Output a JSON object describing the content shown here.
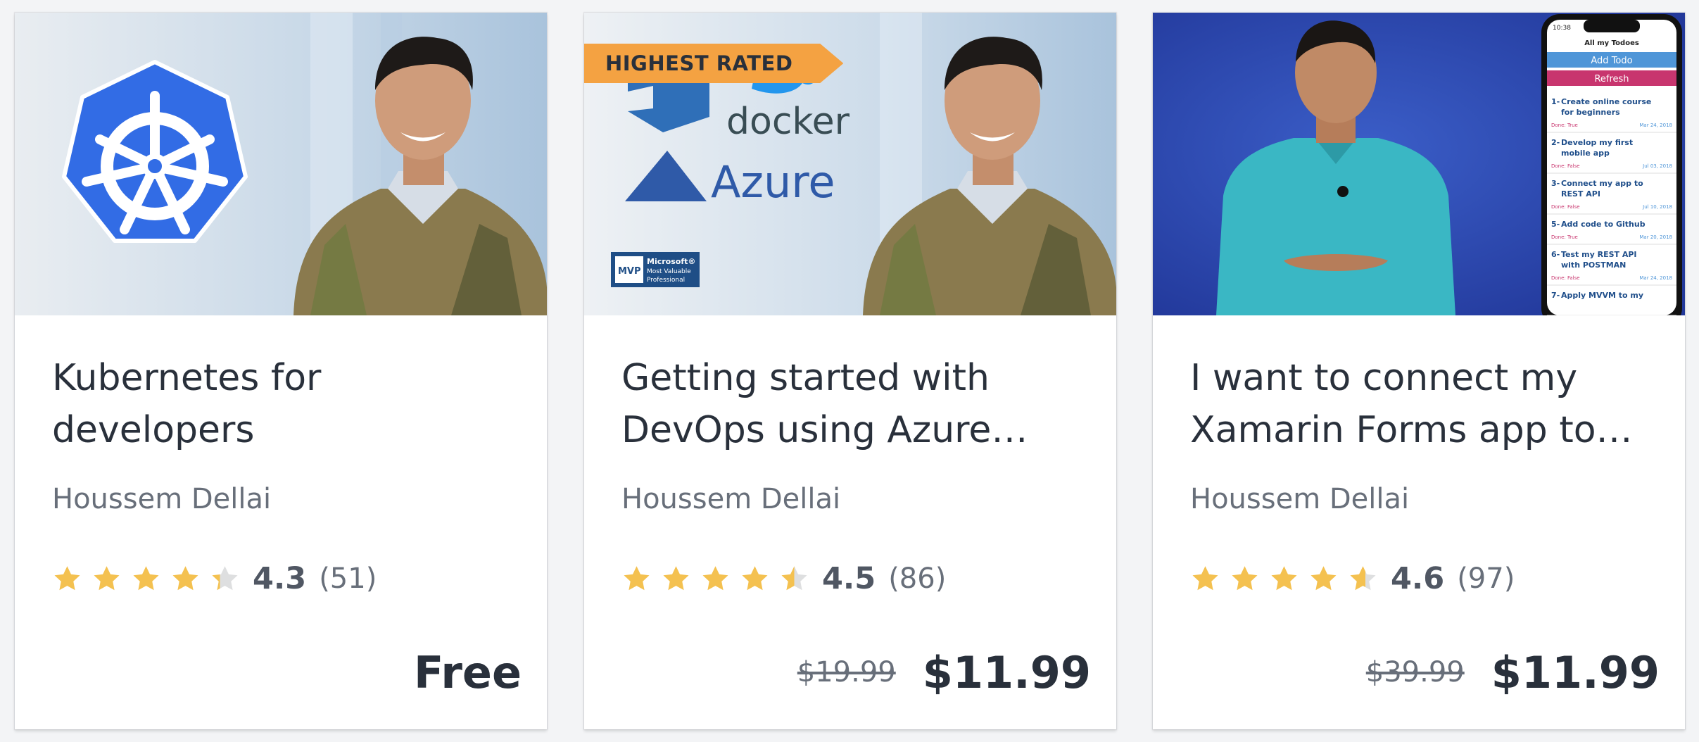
{
  "colors": {
    "star_fill": "#f4c150",
    "star_empty": "#dedfe0",
    "badge_bg": "#f4a242",
    "kubernetes_blue": "#326ce5",
    "azure_blue": "#2f5aa8",
    "phone_nav_blue": "#4f96d8",
    "phone_refresh_pink": "#c8356e"
  },
  "cards": [
    {
      "title": "Kubernetes for developers",
      "author": "Houssem Dellai",
      "rating": 4.3,
      "rating_text": "4.3",
      "reviews": "(51)",
      "price": "Free",
      "original_price": "",
      "thumbnail": {
        "logo": "kubernetes-helm-icon"
      }
    },
    {
      "badge": "HIGHEST RATED",
      "title": "Getting started with DevOps using Azure…",
      "author": "Houssem Dellai",
      "rating": 4.5,
      "rating_text": "4.5",
      "reviews": "(86)",
      "price": "$11.99",
      "original_price": "$19.99",
      "thumbnail": {
        "docker_text": "docker",
        "azure_text": "Azure",
        "mvp_lines": [
          "MVP",
          "Microsoft®",
          "Most Valuable",
          "Professional"
        ]
      }
    },
    {
      "title": "I want to connect my Xamarin Forms app to…",
      "author": "Houssem Dellai",
      "rating": 4.6,
      "rating_text": "4.6",
      "reviews": "(97)",
      "price": "$11.99",
      "original_price": "$39.99",
      "thumbnail": {
        "phone_time": "10:38",
        "phone_header": "All my Todoes",
        "add_button": "Add Todo",
        "refresh_button": "Refresh",
        "todos": [
          {
            "num": "1-",
            "line1": "Create online course",
            "line2": "for beginners",
            "done": "Done: True",
            "date": "Mar 24, 2018"
          },
          {
            "num": "2-",
            "line1": "Develop my first",
            "line2": "mobile app",
            "done": "Done: False",
            "date": "Jul 03, 2018"
          },
          {
            "num": "3-",
            "line1": "Connect my app to",
            "line2": "REST API",
            "done": "Done: False",
            "date": "Jul 10, 2018"
          },
          {
            "num": "5-",
            "line1": "Add code to Github",
            "line2": "",
            "done": "Done: True",
            "date": "Mar 20, 2018"
          },
          {
            "num": "6-",
            "line1": "Test my REST API",
            "line2": "with POSTMAN",
            "done": "Done: False",
            "date": "Mar 24, 2018"
          },
          {
            "num": "7-",
            "line1": "Apply MVVM to my",
            "line2": "",
            "done": "",
            "date": ""
          }
        ]
      }
    }
  ]
}
